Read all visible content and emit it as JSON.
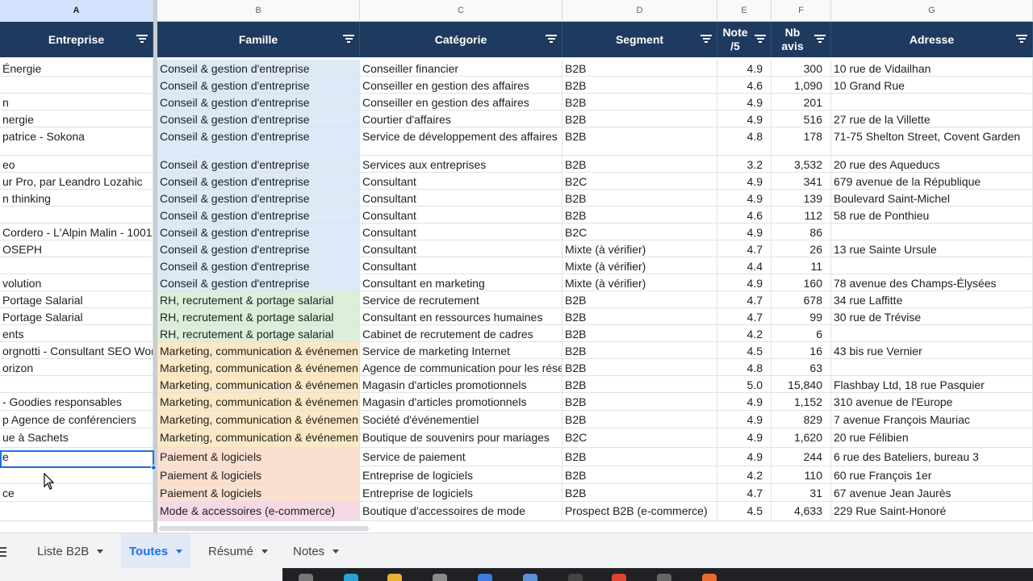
{
  "columns": [
    {
      "letter": "A",
      "header": "Entreprise"
    },
    {
      "letter": "B",
      "header": "Famille"
    },
    {
      "letter": "C",
      "header": "Catégorie"
    },
    {
      "letter": "D",
      "header": "Segment"
    },
    {
      "letter": "E",
      "header": "Note /5"
    },
    {
      "letter": "F",
      "header": "Nb avis"
    },
    {
      "letter": "G",
      "header": "Adresse"
    }
  ],
  "family_colors": {
    "conseil": "#dce9f6",
    "rh": "#dcefd8",
    "mkt": "#fce8c3",
    "pay": "#fbdfcf",
    "mode": "#f6d9e6"
  },
  "rows": [
    {
      "a": "Énergie",
      "b": "Conseil & gestion d'entreprise",
      "fam": "conseil",
      "c": "Conseiller financier",
      "d": "B2B",
      "e": "4.9",
      "f": "300",
      "g": "10 rue de Vidailhan"
    },
    {
      "a": "",
      "b": "Conseil & gestion d'entreprise",
      "fam": "conseil",
      "c": "Conseiller en gestion des affaires",
      "d": "B2B",
      "e": "4.6",
      "f": "1,090",
      "g": "10 Grand Rue"
    },
    {
      "a": "n",
      "b": "Conseil & gestion d'entreprise",
      "fam": "conseil",
      "c": "Conseiller en gestion des affaires",
      "d": "B2B",
      "e": "4.9",
      "f": "201",
      "g": ""
    },
    {
      "a": "nergie",
      "b": "Conseil & gestion d'entreprise",
      "fam": "conseil",
      "c": "Courtier d'affaires",
      "d": "B2B",
      "e": "4.9",
      "f": "516",
      "g": "27 rue de la Villette"
    },
    {
      "a": "patrice - Sokona",
      "b": "Conseil & gestion d'entreprise",
      "fam": "conseil",
      "c": "Service de développement des affaires",
      "d": "B2B",
      "e": "4.8",
      "f": "178",
      "g": "71-75 Shelton Street, Covent Garden"
    },
    {
      "a": "eo",
      "b": "Conseil & gestion d'entreprise",
      "fam": "conseil",
      "c": "Services aux entreprises",
      "d": "B2B",
      "e": "3.2",
      "f": "3,532",
      "g": "20 rue des Aqueducs"
    },
    {
      "a": "ur Pro, par Leandro Lozahic",
      "b": "Conseil & gestion d'entreprise",
      "fam": "conseil",
      "c": "Consultant",
      "d": "B2C",
      "e": "4.9",
      "f": "341",
      "g": "679 avenue de la République"
    },
    {
      "a": "n thinking",
      "b": "Conseil & gestion d'entreprise",
      "fam": "conseil",
      "c": "Consultant",
      "d": "B2B",
      "e": "4.9",
      "f": "139",
      "g": "Boulevard Saint-Michel"
    },
    {
      "a": "",
      "b": "Conseil & gestion d'entreprise",
      "fam": "conseil",
      "c": "Consultant",
      "d": "B2B",
      "e": "4.6",
      "f": "112",
      "g": "58 rue de Ponthieu"
    },
    {
      "a": "Cordero - L'Alpin Malin - 1001",
      "b": "Conseil & gestion d'entreprise",
      "fam": "conseil",
      "c": "Consultant",
      "d": "B2C",
      "e": "4.9",
      "f": "86",
      "g": ""
    },
    {
      "a": "OSEPH",
      "b": "Conseil & gestion d'entreprise",
      "fam": "conseil",
      "c": "Consultant",
      "d": "Mixte (à vérifier)",
      "e": "4.7",
      "f": "26",
      "g": "13 rue Sainte Ursule"
    },
    {
      "a": "",
      "b": "Conseil & gestion d'entreprise",
      "fam": "conseil",
      "c": "Consultant",
      "d": "Mixte (à vérifier)",
      "e": "4.4",
      "f": "11",
      "g": ""
    },
    {
      "a": "volution",
      "b": "Conseil & gestion d'entreprise",
      "fam": "conseil",
      "c": "Consultant en marketing",
      "d": "Mixte (à vérifier)",
      "e": "4.9",
      "f": "160",
      "g": "78 avenue des Champs-Élysées"
    },
    {
      "a": "Portage Salarial",
      "b": "RH, recrutement & portage salarial",
      "fam": "rh",
      "c": "Service de recrutement",
      "d": "B2B",
      "e": "4.7",
      "f": "678",
      "g": "34 rue Laffitte"
    },
    {
      "a": "Portage Salarial",
      "b": "RH, recrutement & portage salarial",
      "fam": "rh",
      "c": "Consultant en ressources humaines",
      "d": "B2B",
      "e": "4.7",
      "f": "99",
      "g": "30 rue de Trévise"
    },
    {
      "a": "ents",
      "b": "RH, recrutement & portage salarial",
      "fam": "rh",
      "c": "Cabinet de recrutement de cadres",
      "d": "B2B",
      "e": "4.2",
      "f": "6",
      "g": ""
    },
    {
      "a": "orgnotti - Consultant SEO Wor",
      "b": "Marketing, communication & événemen",
      "fam": "mkt",
      "c": "Service de marketing Internet",
      "d": "B2B",
      "e": "4.5",
      "f": "16",
      "g": "43 bis rue Vernier"
    },
    {
      "a": "orizon",
      "b": "Marketing, communication & événemen",
      "fam": "mkt",
      "c": "Agence de communication pour les rése",
      "d": "B2B",
      "e": "4.8",
      "f": "63",
      "g": ""
    },
    {
      "a": "",
      "b": "Marketing, communication & événemen",
      "fam": "mkt",
      "c": "Magasin d'articles promotionnels",
      "d": "B2B",
      "e": "5.0",
      "f": "15,840",
      "g": "Flashbay Ltd, 18 rue Pasquier"
    },
    {
      "a": "- Goodies responsables",
      "b": "Marketing, communication & événemen",
      "fam": "mkt",
      "c": "Magasin d'articles promotionnels",
      "d": "B2B",
      "e": "4.9",
      "f": "1,152",
      "g": "310 avenue de l'Europe"
    },
    {
      "a": "p Agence de conférenciers",
      "b": "Marketing, communication & événemen",
      "fam": "mkt",
      "c": "Société d'événementiel",
      "d": "B2B",
      "e": "4.9",
      "f": "829",
      "g": "7 avenue François Mauriac"
    },
    {
      "a": "ue à Sachets",
      "b": "Marketing, communication & événemen",
      "fam": "mkt",
      "c": "Boutique de souvenirs pour mariages",
      "d": "B2C",
      "e": "4.9",
      "f": "1,620",
      "g": "20 rue Félibien"
    },
    {
      "a": "e",
      "b": "Paiement & logiciels",
      "fam": "pay",
      "c": "Service de paiement",
      "d": "B2B",
      "e": "4.9",
      "f": "244",
      "g": "6 rue des Bateliers, bureau 3"
    },
    {
      "a": "",
      "b": "Paiement & logiciels",
      "fam": "pay",
      "c": "Entreprise de logiciels",
      "d": "B2B",
      "e": "4.2",
      "f": "110",
      "g": "60 rue François 1er"
    },
    {
      "a": "ce",
      "b": "Paiement & logiciels",
      "fam": "pay",
      "c": "Entreprise de logiciels",
      "d": "B2B",
      "e": "4.7",
      "f": "31",
      "g": "67 avenue Jean Jaurès"
    },
    {
      "a": "",
      "b": "Mode & accessoires (e-commerce)",
      "fam": "mode",
      "c": "Boutique d'accessoires de mode",
      "d": "Prospect B2B (e-commerce)",
      "e": "4.5",
      "f": "4,633",
      "g": "229 Rue Saint-Honoré"
    }
  ],
  "tabs": [
    {
      "label": "Liste B2B",
      "active": false
    },
    {
      "label": "Toutes",
      "active": true
    },
    {
      "label": "Résumé",
      "active": false
    },
    {
      "label": "Notes",
      "active": false
    }
  ],
  "accent_color": "#1a73e8",
  "header_color": "#1f3a5f"
}
